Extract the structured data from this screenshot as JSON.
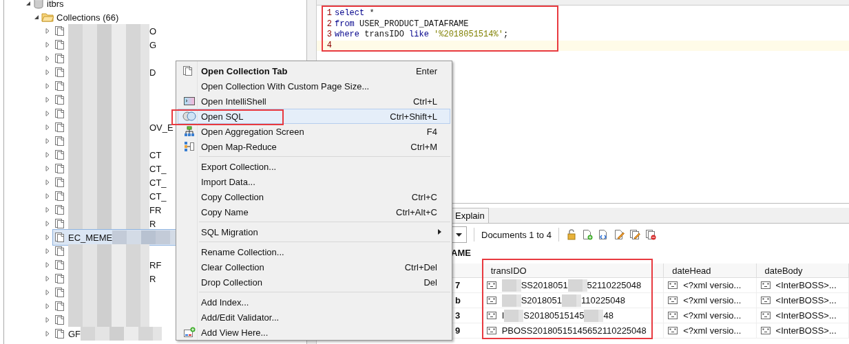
{
  "tree": {
    "database": {
      "label": "itbrs",
      "expanded": true
    },
    "folder": {
      "label": "Collections (66)",
      "expanded": true
    },
    "items": [
      {
        "segments": [
          {
            "kind": "redacted"
          },
          {
            "kind": "text",
            "text": "O"
          }
        ],
        "selected": false
      },
      {
        "segments": [
          {
            "kind": "redacted"
          },
          {
            "kind": "text",
            "text": "G"
          }
        ],
        "selected": false
      },
      {
        "segments": [
          {
            "kind": "redacted"
          }
        ],
        "selected": false
      },
      {
        "segments": [
          {
            "kind": "redacted"
          },
          {
            "kind": "text",
            "text": "D"
          }
        ],
        "selected": false
      },
      {
        "segments": [
          {
            "kind": "redacted"
          }
        ],
        "selected": false
      },
      {
        "segments": [
          {
            "kind": "redacted"
          }
        ],
        "selected": false
      },
      {
        "segments": [
          {
            "kind": "redacted"
          }
        ],
        "selected": false
      },
      {
        "segments": [
          {
            "kind": "redacted"
          },
          {
            "kind": "text",
            "text": "OV_E"
          }
        ],
        "selected": false
      },
      {
        "segments": [
          {
            "kind": "redacted"
          }
        ],
        "selected": false
      },
      {
        "segments": [
          {
            "kind": "redacted"
          },
          {
            "kind": "text",
            "text": "CT"
          }
        ],
        "selected": false
      },
      {
        "segments": [
          {
            "kind": "redacted"
          },
          {
            "kind": "text",
            "text": "CT_"
          }
        ],
        "selected": false
      },
      {
        "segments": [
          {
            "kind": "redacted"
          },
          {
            "kind": "text",
            "text": "CT_"
          }
        ],
        "selected": false
      },
      {
        "segments": [
          {
            "kind": "redacted"
          },
          {
            "kind": "text",
            "text": "CT_"
          }
        ],
        "selected": false
      },
      {
        "segments": [
          {
            "kind": "redacted"
          },
          {
            "kind": "text",
            "text": "FR"
          }
        ],
        "selected": false
      },
      {
        "segments": [
          {
            "kind": "redacted"
          },
          {
            "kind": "text",
            "text": "R"
          }
        ],
        "selected": false
      },
      {
        "segments": [
          {
            "kind": "text",
            "text": "EC_MEME"
          },
          {
            "kind": "redacted"
          }
        ],
        "selected": true
      },
      {
        "segments": [
          {
            "kind": "redacted"
          }
        ],
        "selected": false
      },
      {
        "segments": [
          {
            "kind": "redacted"
          },
          {
            "kind": "text",
            "text": "RF"
          }
        ],
        "selected": false
      },
      {
        "segments": [
          {
            "kind": "redacted"
          },
          {
            "kind": "text",
            "text": "R"
          }
        ],
        "selected": false
      },
      {
        "segments": [
          {
            "kind": "redacted"
          }
        ],
        "selected": false
      },
      {
        "segments": [
          {
            "kind": "redacted"
          }
        ],
        "selected": false
      },
      {
        "segments": [
          {
            "kind": "redacted"
          }
        ],
        "selected": false
      },
      {
        "segments": [
          {
            "kind": "text",
            "text": "GF"
          },
          {
            "kind": "redacted"
          }
        ],
        "selected": false
      }
    ]
  },
  "editor": {
    "lines": [
      {
        "number": "1",
        "current": false,
        "tokens": [
          {
            "kind": "keyword",
            "text": "select"
          },
          {
            "kind": "plain",
            "text": " *"
          }
        ]
      },
      {
        "number": "2",
        "current": false,
        "tokens": [
          {
            "kind": "keyword",
            "text": "from"
          },
          {
            "kind": "plain",
            "text": " USER_PRODUCT_DATAFRAME"
          }
        ]
      },
      {
        "number": "3",
        "current": false,
        "tokens": [
          {
            "kind": "keyword",
            "text": "where"
          },
          {
            "kind": "plain",
            "text": " transIDO "
          },
          {
            "kind": "keyword",
            "text": "like"
          },
          {
            "kind": "string",
            "text": " '%2018051514%'"
          },
          {
            "kind": "plain",
            "text": ";"
          }
        ]
      },
      {
        "number": "4",
        "current": true
      }
    ]
  },
  "context_menu": {
    "items": [
      {
        "kind": "item",
        "label": "Open Collection Tab",
        "shortcut": "Enter",
        "bold": true,
        "selected": false
      },
      {
        "kind": "item",
        "label": "Open Collection With Custom Page Size...",
        "bold": false,
        "selected": false
      },
      {
        "kind": "item",
        "label": "Open IntelliShell",
        "shortcut": "Ctrl+L",
        "bold": false,
        "selected": false
      },
      {
        "kind": "item",
        "label": "Open SQL",
        "shortcut": "Ctrl+Shift+L",
        "bold": false,
        "selected": true
      },
      {
        "kind": "item",
        "label": "Open Aggregation Screen",
        "shortcut": "F4",
        "bold": false,
        "selected": false
      },
      {
        "kind": "item",
        "label": "Open Map-Reduce",
        "shortcut": "Ctrl+M",
        "bold": false,
        "selected": false
      },
      {
        "kind": "separator"
      },
      {
        "kind": "item",
        "label": "Export Collection...",
        "bold": false,
        "selected": false
      },
      {
        "kind": "item",
        "label": "Import Data...",
        "bold": false,
        "selected": false
      },
      {
        "kind": "item",
        "label": "Copy Collection",
        "shortcut": "Ctrl+C",
        "bold": false,
        "selected": false
      },
      {
        "kind": "item",
        "label": "Copy Name",
        "shortcut": "Ctrl+Alt+C",
        "bold": false,
        "selected": false
      },
      {
        "kind": "separator"
      },
      {
        "kind": "submenu",
        "label": "SQL Migration",
        "bold": false,
        "selected": false
      },
      {
        "kind": "separator"
      },
      {
        "kind": "item",
        "label": "Rename Collection...",
        "bold": false,
        "selected": false
      },
      {
        "kind": "item",
        "label": "Clear Collection",
        "shortcut": "Ctrl+Del",
        "bold": false,
        "selected": false
      },
      {
        "kind": "item",
        "label": "Drop Collection",
        "shortcut": "Del",
        "bold": false,
        "selected": false
      },
      {
        "kind": "separator"
      },
      {
        "kind": "item",
        "label": "Add Index...",
        "bold": false,
        "selected": false
      },
      {
        "kind": "item",
        "label": "Add/Edit Validator...",
        "bold": false,
        "selected": false
      },
      {
        "kind": "item",
        "label": "Add View Here...",
        "bold": false,
        "selected": false
      }
    ]
  },
  "results": {
    "tabs": [
      {
        "label": "Explain",
        "selected": false
      }
    ],
    "documents_label": "Documents 1 to 4",
    "collection_name": "AME",
    "columns": [
      "transIDO",
      "dateHead",
      "dateBody"
    ],
    "rows": [
      {
        "id": "7",
        "transIDO": [
          {
            "kind": "redacted"
          },
          {
            "kind": "text",
            "text": "SS2018051"
          },
          {
            "kind": "redacted"
          },
          {
            "kind": "text",
            "text": "52110225048"
          }
        ],
        "dateHead": "<?xml versio...",
        "dateBody": "<InterBOSS>..."
      },
      {
        "id": "b",
        "transIDO": [
          {
            "kind": "redacted"
          },
          {
            "kind": "text",
            "text": "S2018051"
          },
          {
            "kind": "redacted"
          },
          {
            "kind": "text",
            "text": "110225048"
          }
        ],
        "dateHead": "<?xml versio...",
        "dateBody": "<InterBOSS>..."
      },
      {
        "id": "3",
        "transIDO": [
          {
            "kind": "text",
            "text": "I"
          },
          {
            "kind": "redacted"
          },
          {
            "kind": "text",
            "text": "S20180515145"
          },
          {
            "kind": "redacted"
          },
          {
            "kind": "text",
            "text": "48"
          }
        ],
        "dateHead": "<?xml versio...",
        "dateBody": "<InterBOSS>..."
      },
      {
        "id": "9",
        "transIDO": [
          {
            "kind": "text",
            "text": "PBOSS20180515145652110225048"
          }
        ],
        "dateHead": "<?xml versio...",
        "dateBody": "<InterBOSS>..."
      }
    ]
  }
}
